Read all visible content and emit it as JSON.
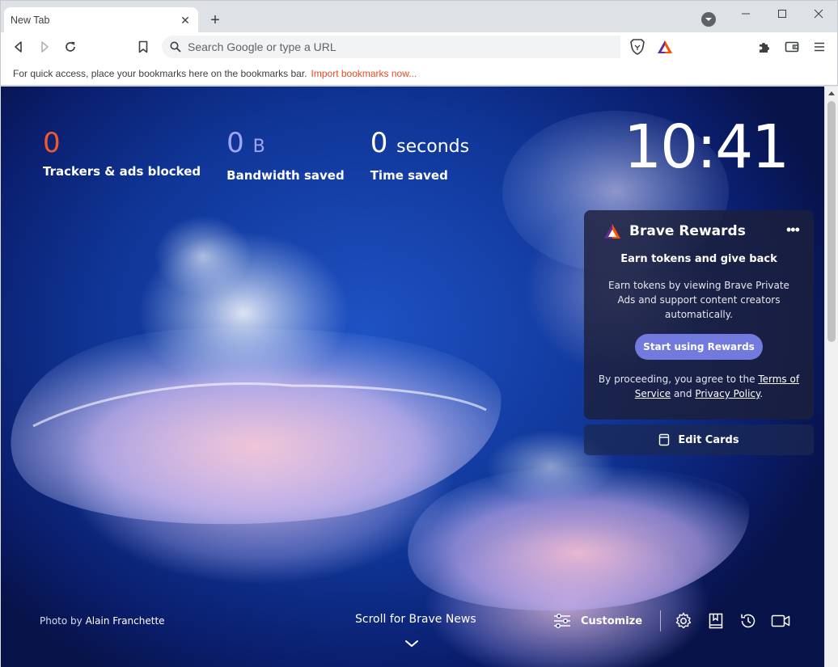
{
  "window": {
    "tab_title": "New Tab",
    "new_tab": "+",
    "tab_close": "✕"
  },
  "toolbar": {
    "search_placeholder": "Search Google or type a URL"
  },
  "bookmarks_bar": {
    "message": "For quick access, place your bookmarks here on the bookmarks bar.",
    "import_link": "Import bookmarks now..."
  },
  "stats": [
    {
      "value": "0",
      "unit": "",
      "label": "Trackers & ads blocked",
      "color": "#f3572d"
    },
    {
      "value": "0",
      "unit": "B",
      "label": "Bandwidth saved",
      "color": "#a0a5f6"
    },
    {
      "value": "0",
      "unit": "seconds",
      "label": "Time saved",
      "color": "#ffffff"
    }
  ],
  "clock": "10:41",
  "rewards": {
    "title": "Brave Rewards",
    "more": "•••",
    "subtitle": "Earn tokens and give back",
    "description": "Earn tokens by viewing Brave Private Ads and support content creators automatically.",
    "button": "Start using Rewards",
    "legal_prefix": "By proceeding, you agree to the",
    "terms": "Terms of Service",
    "legal_and": "and",
    "privacy": "Privacy Policy",
    "legal_suffix": "."
  },
  "edit_cards": "Edit Cards",
  "footer": {
    "photo_by": "Photo by",
    "photographer": "Alain Franchette",
    "scroll_news": "Scroll for Brave News",
    "customize": "Customize"
  },
  "colors": {
    "accent": "#737ade",
    "brave_orange": "#e9491f"
  }
}
